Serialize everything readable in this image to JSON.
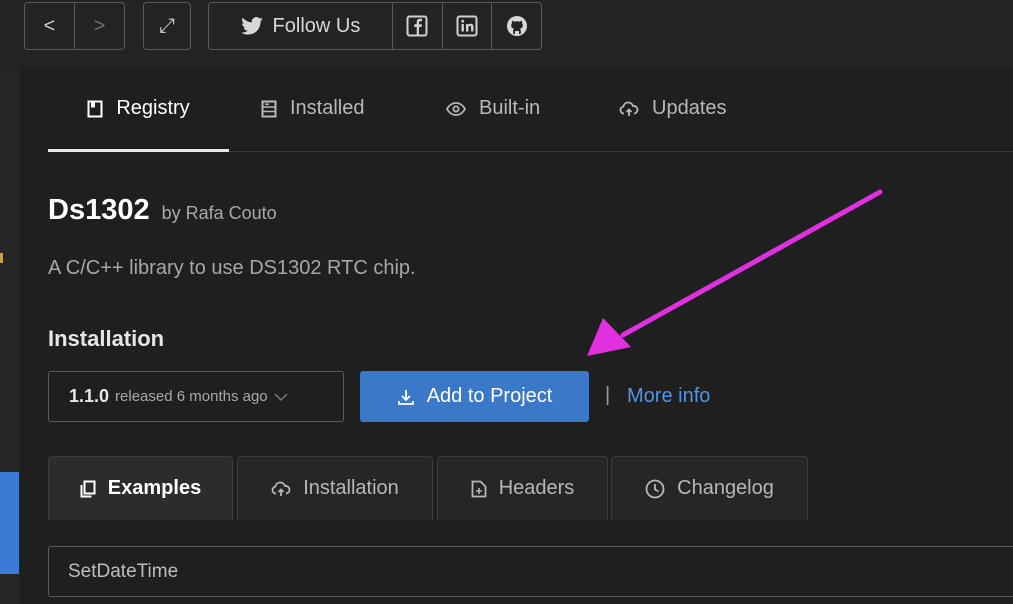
{
  "toolbar": {
    "back_glyph": "<",
    "forward_glyph": ">",
    "expand_glyph": "⤢",
    "follow_label": "Follow Us",
    "icons": [
      "back-icon",
      "forward-icon",
      "expand-icon",
      "twitter-icon",
      "facebook-icon",
      "linkedin-icon",
      "github-icon"
    ]
  },
  "tabs": [
    {
      "label": "Registry",
      "icon": "bookmark-icon",
      "glyph": "❐"
    },
    {
      "label": "Installed",
      "icon": "server-icon",
      "glyph": "▤"
    },
    {
      "label": "Built-in",
      "icon": "eye-icon",
      "glyph": "◉"
    },
    {
      "label": "Updates",
      "icon": "cloud-icon",
      "glyph": "☁"
    }
  ],
  "library": {
    "name": "Ds1302",
    "author": "by Rafa Couto",
    "description": "A C/C++ library to use DS1302 RTC chip."
  },
  "installation": {
    "heading": "Installation",
    "version": "1.1.0",
    "released": "released 6 months ago",
    "add_label": "Add to Project",
    "separator": "|",
    "more_info": "More info"
  },
  "subtabs": [
    {
      "label": "Examples",
      "icon": "copy-icon",
      "glyph": "❏"
    },
    {
      "label": "Installation",
      "icon": "cloud-icon",
      "glyph": "☁"
    },
    {
      "label": "Headers",
      "icon": "file-icon",
      "glyph": "⊞"
    },
    {
      "label": "Changelog",
      "icon": "clock-icon",
      "glyph": "◷"
    }
  ],
  "example_select": {
    "value": "SetDateTime"
  },
  "colors": {
    "accent": "#3c78c8",
    "link": "#4e94e8",
    "annotation_arrow": "#e030e0"
  }
}
